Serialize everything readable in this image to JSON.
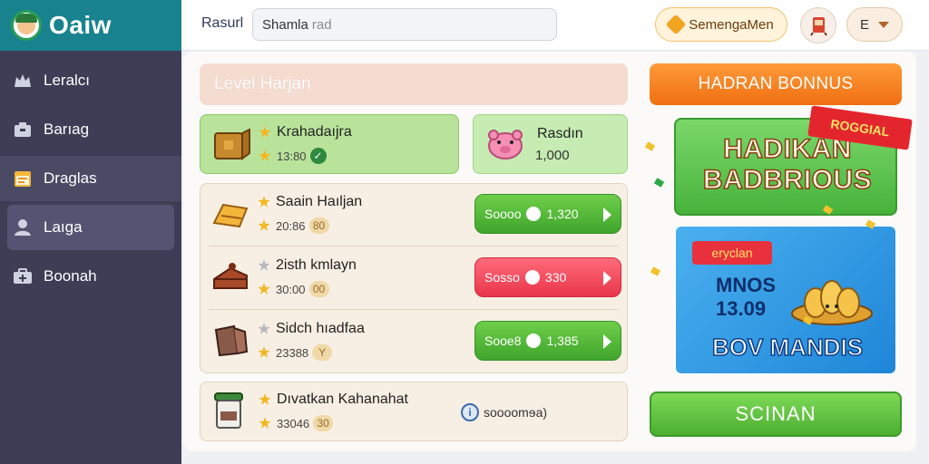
{
  "app": {
    "name": "Oaiw"
  },
  "sidebar": {
    "items": [
      {
        "label": "Leralcı",
        "icon": "crown-icon"
      },
      {
        "label": "Barıag",
        "icon": "box-icon"
      },
      {
        "label": "Draglas",
        "icon": "calendar-icon"
      },
      {
        "label": "Laıga",
        "icon": "user-icon"
      },
      {
        "label": "Boonah",
        "icon": "medkit-icon"
      }
    ]
  },
  "topbar": {
    "label": "Rasurl",
    "search_value": "Shamla",
    "search_placeholder": "rad",
    "promo_button": "SemengaMen",
    "lang_button": "E"
  },
  "main": {
    "level_label": "Level Harjan",
    "featured": [
      {
        "title": "Krahadaıjra",
        "value": "13:80",
        "badge": "✓"
      },
      {
        "title": "Rasdın",
        "value": "1,000"
      }
    ],
    "items": [
      {
        "title": "Saain Haıljan",
        "value": "20:86",
        "badge": "80",
        "action": "Soooo",
        "price": "1,320",
        "action_color": "green",
        "star": "gold"
      },
      {
        "title": "2isth kmlayn",
        "value": "30:00",
        "badge": "00",
        "action": "Sosso",
        "price": "330",
        "action_color": "red",
        "star": "grey"
      },
      {
        "title": "Sidch hıadfaa",
        "value": "23388",
        "badge": "Y",
        "action": "Sooe8",
        "price": "1,385",
        "action_color": "green",
        "star": "grey"
      }
    ],
    "last_item": {
      "title": "Dıvatkan Kahanahat",
      "value": "33046",
      "badge": "30",
      "info_text": "soooomɘa)"
    }
  },
  "bonus": {
    "header": "HADRAN BONNUS",
    "banner1_line1": "HADIKAN",
    "banner1_line2": "BADBRIOUS",
    "ribbon": "ROGGIAL",
    "banner2_tag": "eryclan",
    "banner2_line1": "MNOS",
    "banner2_line2": "13.09",
    "banner2_title": "BOV MANDIS",
    "scan_button": "SCINAN"
  },
  "colors": {
    "sidebar_bg": "#3d3d55",
    "brand_bg": "#18838f",
    "accent_orange": "#ef6f10",
    "accent_green": "#4caf32",
    "accent_red": "#e8364a"
  }
}
